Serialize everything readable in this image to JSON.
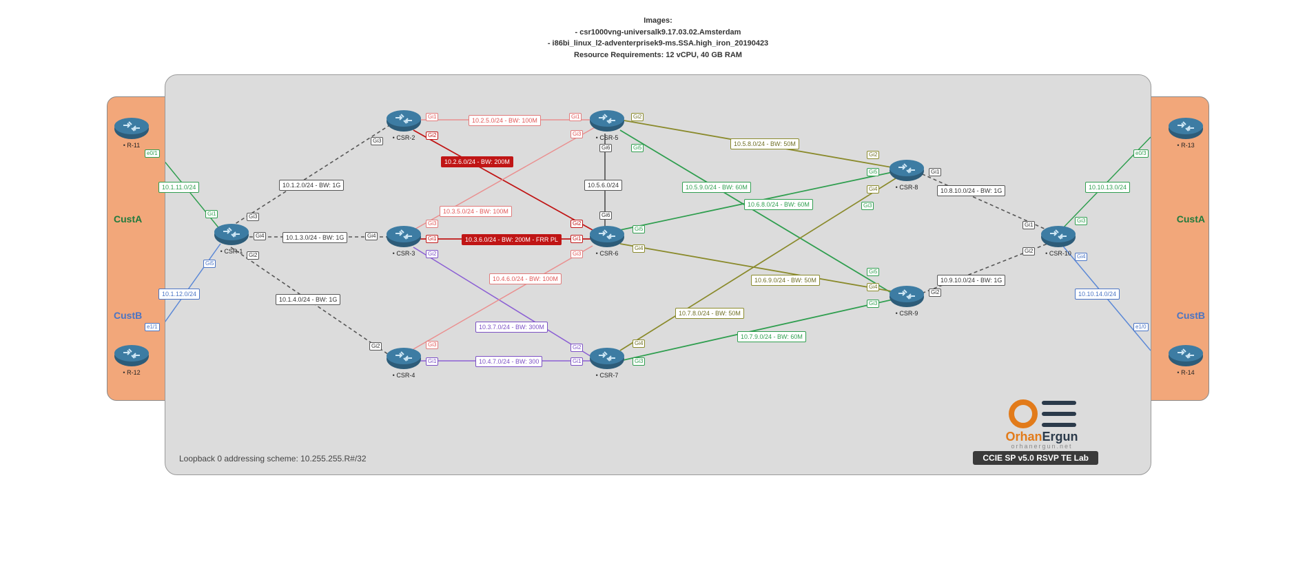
{
  "header": {
    "title": "Images:",
    "line1": "- csr1000vng-universalk9.17.03.02.Amsterdam",
    "line2": "- i86bi_linux_l2-adventerprisek9-ms.SSA.high_iron_20190423",
    "line3": "Resource Requirements: 12 vCPU, 40 GB RAM"
  },
  "zones": {
    "custA_left": "CustA",
    "custB_left": "CustB",
    "custA_right": "CustA",
    "custB_right": "CustB"
  },
  "routers": {
    "r11": "R-11",
    "r12": "R-12",
    "r13": "R-13",
    "r14": "R-14",
    "csr1": "CSR-1",
    "csr2": "CSR-2",
    "csr3": "CSR-3",
    "csr4": "CSR-4",
    "csr5": "CSR-5",
    "csr6": "CSR-6",
    "csr7": "CSR-7",
    "csr8": "CSR-8",
    "csr9": "CSR-9",
    "csr10": "CSR-10"
  },
  "links": {
    "l_1_11": "10.1.11.0/24",
    "l_1_12": "10.1.12.0/24",
    "l_1_2": "10.1.2.0/24 - BW: 1G",
    "l_1_3": "10.1.3.0/24 - BW: 1G",
    "l_1_4": "10.1.4.0/24 - BW: 1G",
    "l_2_5": "10.2.5.0/24 - BW: 100M",
    "l_2_6": "10.2.6.0/24 - BW: 200M",
    "l_3_5": "10.3.5.0/24 - BW: 100M",
    "l_3_6": "10.3.6.0/24 - BW: 200M - FRR PL",
    "l_3_7": "10.3.7.0/24 - BW: 300M",
    "l_4_6": "10.4.6.0/24 - BW: 100M",
    "l_4_7": "10.4.7.0/24 - BW: 300",
    "l_5_6": "10.5.6.0/24",
    "l_5_8": "10.5.8.0/24 - BW: 50M",
    "l_5_9": "10.5.9.0/24 - BW: 60M",
    "l_6_8": "10.6.8.0/24 - BW: 60M",
    "l_6_9": "10.6.9.0/24 - BW: 50M",
    "l_7_8": "10.7.8.0/24 - BW: 50M",
    "l_7_9": "10.7.9.0/24 - BW: 60M",
    "l_8_10": "10.8.10.0/24 - BW: 1G",
    "l_9_10": "10.9.10.0/24 - BW: 1G",
    "l_10_13": "10.10.13.0/24",
    "l_10_14": "10.10.14.0/24"
  },
  "ports": {
    "r11_e01": "e0/1",
    "r12_e11": "e1/1",
    "r13_e03": "e0/3",
    "r14_e10": "e1/0",
    "c1_gi1": "Gi1",
    "c1_gi2": "Gi2",
    "c1_gi3": "Gi3",
    "c1_gi4": "Gi4",
    "c1_gi5": "Gi5",
    "c2_gi1": "Gi1",
    "c2_gi2": "Gi2",
    "c2_gi3": "Gi3",
    "c3_gi1": "Gi1",
    "c3_gi2": "Gi2",
    "c3_gi3": "Gi3",
    "c3_gi4": "Gi4",
    "c4_gi1": "Gi1",
    "c4_gi2": "Gi2",
    "c4_gi3": "Gi3",
    "c5_gi1": "Gi1",
    "c5_gi2": "Gi2",
    "c5_gi3": "Gi3",
    "c5_gi5": "Gi5",
    "c5_gi6": "Gi6",
    "c6_gi1": "Gi1",
    "c6_gi2": "Gi2",
    "c6_gi3": "Gi3",
    "c6_gi4": "Gi4",
    "c6_gi5": "Gi5",
    "c6_gi6": "Gi6",
    "c7_gi1": "Gi1",
    "c7_gi2": "Gi2",
    "c7_gi3": "Gi3",
    "c7_gi4": "Gi4",
    "c8_gi1": "Gi1",
    "c8_gi2": "Gi2",
    "c8_gi3": "Gi3",
    "c8_gi4": "Gi4",
    "c8_gi5": "Gi5",
    "c9_gi2": "Gi2",
    "c9_gi3": "Gi3",
    "c9_gi4": "Gi4",
    "c9_gi5": "Gi5",
    "c10_gi1": "Gi1",
    "c10_gi2": "Gi2",
    "c10_gi3": "Gi3",
    "c10_gi4": "Gi4"
  },
  "footer": {
    "loopback": "Loopback 0 addressing scheme: 10.255.255.R#/32",
    "badge": "CCIE SP v5.0 RSVP TE Lab",
    "logo_main": "Orhan",
    "logo_main2": "Ergun",
    "logo_sub": "orhanergun.net"
  },
  "chart_data": {
    "type": "network-topology",
    "loopback_scheme": "10.255.255.R#/32",
    "images": [
      "csr1000vng-universalk9.17.03.02.Amsterdam",
      "i86bi_linux_l2-adventerprisek9-ms.SSA.high_iron_20190423"
    ],
    "resource_requirements": "12 vCPU, 40 GB RAM",
    "nodes": [
      {
        "id": "R-11",
        "zone": "CustA-left"
      },
      {
        "id": "R-12",
        "zone": "CustB-left"
      },
      {
        "id": "R-13",
        "zone": "CustA-right"
      },
      {
        "id": "R-14",
        "zone": "CustB-right"
      },
      {
        "id": "CSR-1"
      },
      {
        "id": "CSR-2"
      },
      {
        "id": "CSR-3"
      },
      {
        "id": "CSR-4"
      },
      {
        "id": "CSR-5"
      },
      {
        "id": "CSR-6"
      },
      {
        "id": "CSR-7"
      },
      {
        "id": "CSR-8"
      },
      {
        "id": "CSR-9"
      },
      {
        "id": "CSR-10"
      }
    ],
    "edges": [
      {
        "a": "R-11",
        "pa": "e0/1",
        "b": "CSR-1",
        "pb": "Gi1",
        "net": "10.1.11.0/24",
        "color": "green"
      },
      {
        "a": "R-12",
        "pa": "e1/1",
        "b": "CSR-1",
        "pb": "Gi5",
        "net": "10.1.12.0/24",
        "color": "blue"
      },
      {
        "a": "CSR-1",
        "pa": "Gi3",
        "b": "CSR-2",
        "pb": "Gi3",
        "net": "10.1.2.0/24",
        "bw": "1G",
        "color": "gray-dash"
      },
      {
        "a": "CSR-1",
        "pa": "Gi4",
        "b": "CSR-3",
        "pb": "Gi4",
        "net": "10.1.3.0/24",
        "bw": "1G",
        "color": "gray-dash"
      },
      {
        "a": "CSR-1",
        "pa": "Gi2",
        "b": "CSR-4",
        "pb": "Gi2",
        "net": "10.1.4.0/24",
        "bw": "1G",
        "color": "gray-dash"
      },
      {
        "a": "CSR-2",
        "pa": "Gi1",
        "b": "CSR-5",
        "pb": "Gi1",
        "net": "10.2.5.0/24",
        "bw": "100M",
        "color": "pink"
      },
      {
        "a": "CSR-2",
        "pa": "Gi2",
        "b": "CSR-6",
        "pb": "Gi2",
        "net": "10.2.6.0/24",
        "bw": "200M",
        "color": "red"
      },
      {
        "a": "CSR-3",
        "pa": "Gi3",
        "b": "CSR-5",
        "pb": "Gi3",
        "net": "10.3.5.0/24",
        "bw": "100M",
        "color": "pink"
      },
      {
        "a": "CSR-3",
        "pa": "Gi1",
        "b": "CSR-6",
        "pb": "Gi1",
        "net": "10.3.6.0/24",
        "bw": "200M",
        "flags": "FRR PL",
        "color": "red"
      },
      {
        "a": "CSR-3",
        "pa": "Gi2",
        "b": "CSR-7",
        "pb": "Gi2",
        "net": "10.3.7.0/24",
        "bw": "300M",
        "color": "purple"
      },
      {
        "a": "CSR-4",
        "pa": "Gi3",
        "b": "CSR-6",
        "pb": "Gi3",
        "net": "10.4.6.0/24",
        "bw": "100M",
        "color": "pink"
      },
      {
        "a": "CSR-4",
        "pa": "Gi1",
        "b": "CSR-7",
        "pb": "Gi1",
        "net": "10.4.7.0/24",
        "bw": "300",
        "color": "purple"
      },
      {
        "a": "CSR-5",
        "pa": "Gi6",
        "b": "CSR-6",
        "pb": "Gi6",
        "net": "10.5.6.0/24",
        "color": "gray"
      },
      {
        "a": "CSR-5",
        "pa": "Gi2",
        "b": "CSR-8",
        "pb": "Gi2",
        "net": "10.5.8.0/24",
        "bw": "50M",
        "color": "olive"
      },
      {
        "a": "CSR-5",
        "pa": "Gi5",
        "b": "CSR-9",
        "pb": "Gi5",
        "net": "10.5.9.0/24",
        "bw": "60M",
        "color": "green"
      },
      {
        "a": "CSR-6",
        "pa": "Gi5",
        "b": "CSR-8",
        "pb": "Gi5",
        "net": "10.6.8.0/24",
        "bw": "60M",
        "color": "green"
      },
      {
        "a": "CSR-6",
        "pa": "Gi4",
        "b": "CSR-9",
        "pb": "Gi4",
        "net": "10.6.9.0/24",
        "bw": "50M",
        "color": "olive"
      },
      {
        "a": "CSR-7",
        "pa": "Gi4",
        "b": "CSR-8",
        "pb": "Gi4",
        "net": "10.7.8.0/24",
        "bw": "50M",
        "color": "olive"
      },
      {
        "a": "CSR-7",
        "pa": "Gi3",
        "b": "CSR-9",
        "pb": "Gi3",
        "net": "10.7.9.0/24",
        "bw": "60M",
        "color": "green"
      },
      {
        "a": "CSR-8",
        "pa": "Gi1",
        "b": "CSR-10",
        "pb": "Gi1",
        "net": "10.8.10.0/24",
        "bw": "1G",
        "color": "gray-dash"
      },
      {
        "a": "CSR-9",
        "pa": "Gi2",
        "b": "CSR-10",
        "pb": "Gi2",
        "net": "10.9.10.0/24",
        "bw": "1G",
        "color": "gray-dash"
      },
      {
        "a": "CSR-10",
        "pa": "Gi3",
        "b": "R-13",
        "pb": "e0/3",
        "net": "10.10.13.0/24",
        "color": "green"
      },
      {
        "a": "CSR-10",
        "pa": "Gi4",
        "b": "R-14",
        "pb": "e1/0",
        "net": "10.10.14.0/24",
        "color": "blue"
      }
    ]
  }
}
